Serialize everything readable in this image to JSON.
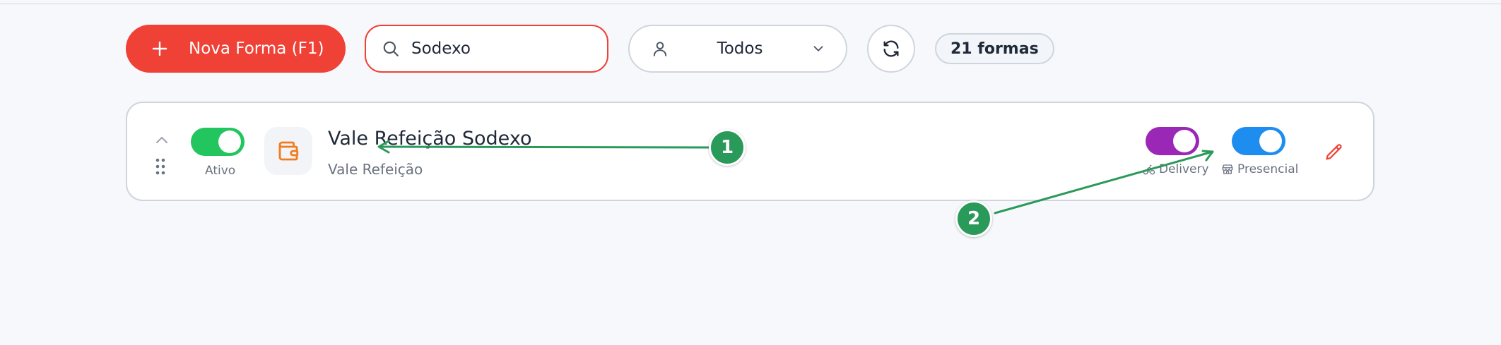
{
  "toolbar": {
    "new_button_label": "Nova Forma (F1)",
    "search_value": "Sodexo",
    "filter_label": "Todos",
    "count_label": "21 formas"
  },
  "card": {
    "active_label": "Ativo",
    "name": "Vale Refeição Sodexo",
    "type": "Vale Refeição",
    "delivery_label": "Delivery",
    "presencial_label": "Presencial",
    "active_on": true,
    "delivery_on": true,
    "presencial_on": true
  },
  "annotations": {
    "marker_1": "1",
    "marker_2": "2"
  },
  "colors": {
    "primary": "#ef4136",
    "active_toggle": "#22c55e",
    "delivery_toggle": "#9b27b6",
    "presencial_toggle": "#1d8df0",
    "annotation": "#2a9a5a",
    "wallet_icon": "#f07c1e"
  },
  "icons": [
    "plus-icon",
    "search-icon",
    "user-icon",
    "chevron-down-icon",
    "refresh-icon",
    "chevron-up-icon",
    "drag-handle-icon",
    "wallet-icon",
    "bike-icon",
    "store-icon",
    "pencil-icon"
  ]
}
